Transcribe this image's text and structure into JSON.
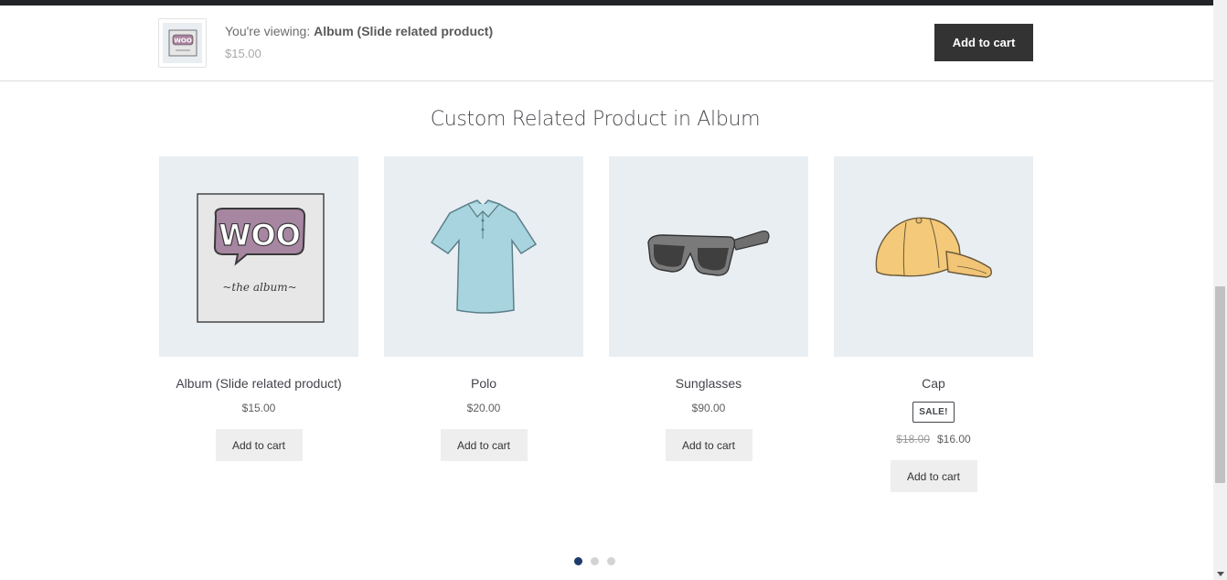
{
  "sticky_bar": {
    "viewing_prefix": "You're viewing: ",
    "product_name": "Album (Slide related product)",
    "price": "$15.00",
    "add_to_cart": "Add to cart",
    "thumb_logo": "WOO"
  },
  "section": {
    "title": "Custom Related Product in Album"
  },
  "products": [
    {
      "name": "Album (Slide related product)",
      "price": "$15.00",
      "button": "Add to cart",
      "image": "album-image",
      "album_logo": "WOO",
      "album_caption": "~the   album~"
    },
    {
      "name": "Polo",
      "price": "$20.00",
      "button": "Add to cart",
      "image": "polo-shirt-image"
    },
    {
      "name": "Sunglasses",
      "price": "$90.00",
      "button": "Add to cart",
      "image": "sunglasses-image"
    },
    {
      "name": "Cap",
      "sale_badge": "SALE!",
      "old_price": "$18.00",
      "price": "$16.00",
      "button": "Add to cart",
      "image": "cap-image"
    }
  ],
  "carousel": {
    "pages": 3,
    "active_page": 1
  },
  "colors": {
    "dark_button": "#333333",
    "product_bg": "#e9eef2",
    "active_dot": "#1f3b6b"
  }
}
